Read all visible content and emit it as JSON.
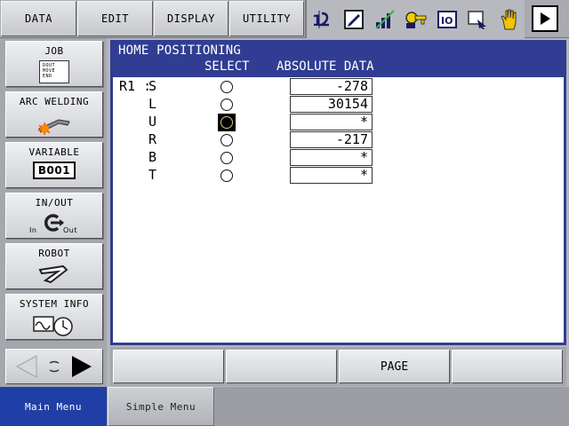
{
  "top_menu": [
    {
      "label": "DATA"
    },
    {
      "label": "EDIT"
    },
    {
      "label": "DISPLAY"
    },
    {
      "label": "UTILITY"
    }
  ],
  "toolbar_icons": [
    "numbered-steps-icon",
    "edit-square-icon",
    "signal-bars-icon",
    "key-icon",
    "io-register-icon",
    "display-arrow-icon",
    "hand-icon"
  ],
  "sidebar": {
    "items": [
      {
        "label": "JOB",
        "icon": "job-document-icon",
        "icon_text": [
          "DOUT",
          "MOVE",
          "END"
        ]
      },
      {
        "label": "ARC WELDING",
        "icon": "welding-torch-icon"
      },
      {
        "label": "VARIABLE",
        "icon": "variable-icon",
        "icon_text": "B001"
      },
      {
        "label": "IN/OUT",
        "icon": "in-out-icon",
        "icon_in": "In",
        "icon_out": "Out"
      },
      {
        "label": "ROBOT",
        "icon": "robot-arm-icon"
      },
      {
        "label": "SYSTEM INFO",
        "icon": "system-info-icon"
      }
    ]
  },
  "main": {
    "title": "HOME POSITIONING",
    "col_select": "SELECT",
    "col_absolute": "ABSOLUTE DATA",
    "rows": [
      {
        "prefix": "R1 :",
        "axis": "S",
        "selected": false,
        "value": "-278"
      },
      {
        "prefix": "",
        "axis": "L",
        "selected": false,
        "value": "30154"
      },
      {
        "prefix": "",
        "axis": "U",
        "selected": true,
        "value": "*"
      },
      {
        "prefix": "",
        "axis": "R",
        "selected": false,
        "value": "-217"
      },
      {
        "prefix": "",
        "axis": "B",
        "selected": false,
        "value": "*"
      },
      {
        "prefix": "",
        "axis": "T",
        "selected": false,
        "value": "*"
      }
    ]
  },
  "function_keys": [
    {
      "label": ""
    },
    {
      "label": ""
    },
    {
      "label": "PAGE"
    },
    {
      "label": ""
    }
  ],
  "bottom": {
    "main_menu": "Main Menu",
    "simple_menu": "Simple Menu"
  },
  "colors": {
    "header_blue": "#303d92",
    "main_menu_blue": "#1f3fa6",
    "panel_gray": "#b4b6bc"
  }
}
